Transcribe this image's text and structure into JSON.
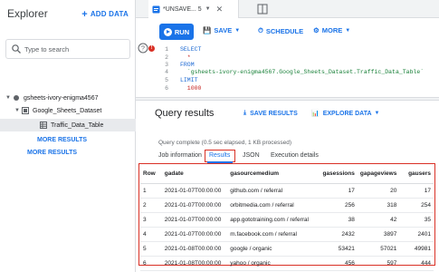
{
  "explorer": {
    "title": "Explorer",
    "add_data": "ADD DATA",
    "search_placeholder": "Type to search",
    "project": "gsheets-ivory-enigma4567",
    "dataset": "Google_Sheets_Dataset",
    "table": "Traffic_Data_Table",
    "more_results_1": "MORE RESULTS",
    "more_results_2": "MORE RESULTS"
  },
  "tab": {
    "label": "*UNSAVE... 5"
  },
  "toolbar": {
    "run": "RUN",
    "save": "SAVE",
    "schedule": "SCHEDULE",
    "more": "MORE"
  },
  "editor": {
    "line_numbers": [
      "1",
      "2",
      "3",
      "4",
      "5",
      "6"
    ],
    "lines": [
      "SELECT",
      "  *",
      "FROM",
      "  `gsheets-ivory-enigma4567.Google_Sheets_Dataset.Traffic_Data_Table`",
      "LIMIT",
      "  1000"
    ]
  },
  "results": {
    "title": "Query results",
    "save_results": "SAVE RESULTS",
    "explore_data": "EXPLORE DATA",
    "status": "Query complete (0.5 sec elapsed, 1 KB processed)",
    "tabs": [
      "Job information",
      "Results",
      "JSON",
      "Execution details"
    ],
    "columns": [
      "Row",
      "gadate",
      "gasourcemedium",
      "gasessions",
      "gapageviews",
      "gausers"
    ],
    "rows": [
      [
        "1",
        "2021-01-07T00:00:00",
        "github.com / referral",
        "17",
        "20",
        "17"
      ],
      [
        "2",
        "2021-01-07T00:00:00",
        "orbitmedia.com / referral",
        "256",
        "318",
        "254"
      ],
      [
        "3",
        "2021-01-07T00:00:00",
        "app.gototraining.com / referral",
        "38",
        "42",
        "35"
      ],
      [
        "4",
        "2021-01-07T00:00:00",
        "m.facebook.com / referral",
        "2432",
        "3897",
        "2401"
      ],
      [
        "5",
        "2021-01-08T00:00:00",
        "google / organic",
        "53421",
        "57021",
        "49981"
      ],
      [
        "6",
        "2021-01-08T00:00:00",
        "yahoo / organic",
        "456",
        "597",
        "444"
      ]
    ]
  },
  "colors": {
    "accent": "#1a73e8",
    "highlight": "#d93025"
  }
}
